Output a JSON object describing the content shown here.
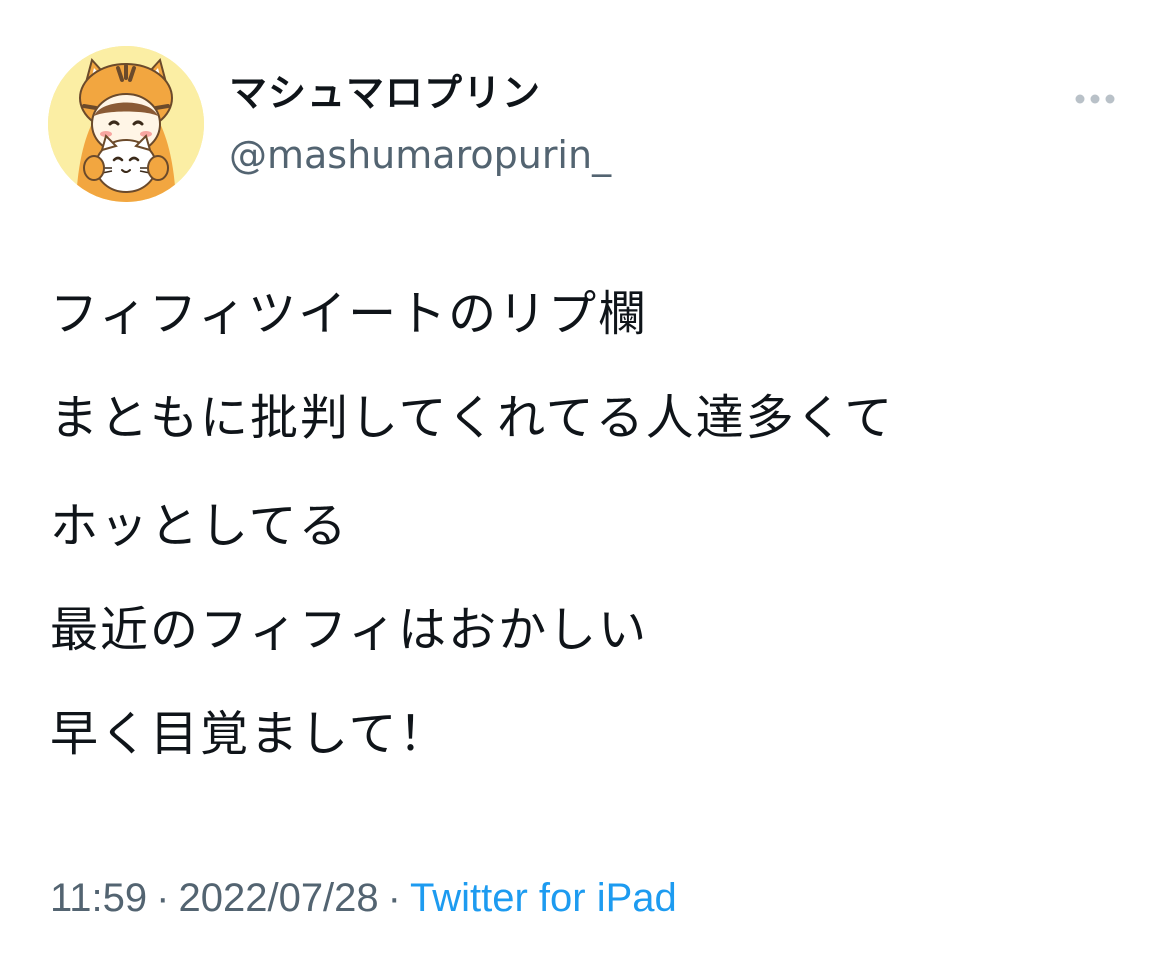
{
  "tweet": {
    "author": {
      "display_name": "マシュマロプリン",
      "handle": "@mashumaropurin_",
      "avatar_icon": "tiger-hood-character-avatar"
    },
    "more_icon": "more-dots-icon",
    "lines": [
      "フィフィツイートのリプ欄",
      "まともに批判してくれてる人達多くて",
      "ホッとしてる",
      "最近のフィフィはおかしい",
      "早く目覚まして！"
    ],
    "time": "11:59",
    "date": "2022/07/28",
    "separator": "·",
    "source": "Twitter for iPad"
  },
  "colors": {
    "text": "#0f1419",
    "secondary": "#536471",
    "link": "#1d9bf0",
    "avatar_bg": "#fbeea4"
  }
}
